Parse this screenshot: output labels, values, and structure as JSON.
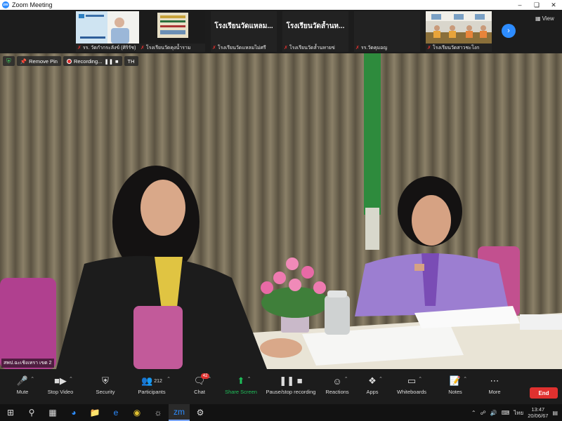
{
  "window": {
    "title": "Zoom Meeting",
    "app_icon_text": "zm"
  },
  "gallery": {
    "tiles": [
      {
        "label": "รร. วัดกำกระลังข์ (ศิริรัช)",
        "name_text": ""
      },
      {
        "label": "โรงเรียนวัดคุงน้ำราม",
        "name_text": ""
      },
      {
        "label": "โรงเรียนวัดแหลมไม่ศรี",
        "name_text": "โรงเรียนวัดแหลม..."
      },
      {
        "label": "โรงเรียนวัดล้ำนหายข่",
        "name_text": "โรงเรียนวัดล้ำนห..."
      },
      {
        "label": "รร.วัดคุมอญ",
        "name_text": ""
      },
      {
        "label": "โรงเรียนวัดสาวชะโงก",
        "name_text": ""
      }
    ],
    "view_label": "View"
  },
  "main": {
    "remove_pin": "Remove Pin",
    "recording": "Recording...",
    "language": "TH",
    "speaker_label": "สพป.ฉะเชิงเทรา เขต 2"
  },
  "toolbar": {
    "mute": "Mute",
    "stop_video": "Stop Video",
    "security": "Security",
    "participants": "Participants",
    "participants_count": "212",
    "chat": "Chat",
    "chat_badge": "42",
    "share_screen": "Share Screen",
    "pause_recording": "Pause/stop recording",
    "reactions": "Reactions",
    "apps": "Apps",
    "whiteboards": "Whiteboards",
    "notes": "Notes",
    "more": "More",
    "end": "End"
  },
  "taskbar": {
    "lang": "ไทย",
    "time": "13:47",
    "date": "20/06/67"
  }
}
